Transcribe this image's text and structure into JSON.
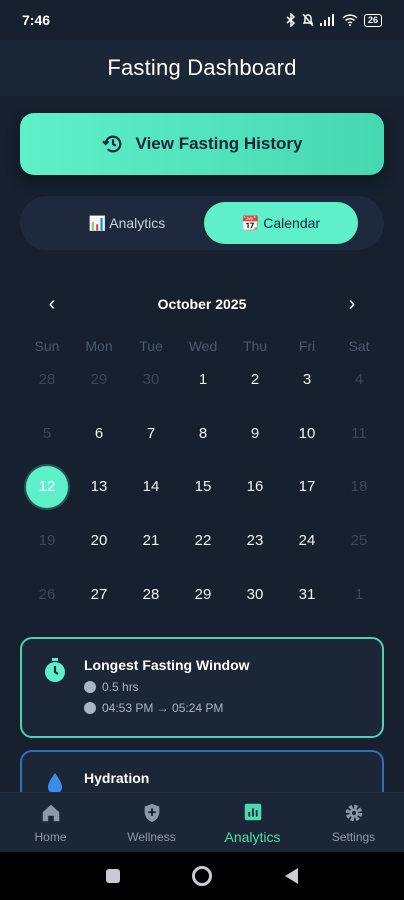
{
  "status_bar": {
    "time": "7:46",
    "battery": "26"
  },
  "header": {
    "title": "Fasting Dashboard"
  },
  "history_button": {
    "label": "View Fasting History",
    "icon": "history-icon"
  },
  "tabs": [
    {
      "label": "📊 Analytics",
      "active": false
    },
    {
      "label": "📆 Calendar",
      "active": true
    }
  ],
  "calendar": {
    "month": "October 2025",
    "prev": "‹",
    "next": "›",
    "weekdays": [
      "Sun",
      "Mon",
      "Tue",
      "Wed",
      "Thu",
      "Fri",
      "Sat"
    ],
    "days": [
      {
        "label": "28",
        "muted": true
      },
      {
        "label": "29",
        "muted": true
      },
      {
        "label": "30",
        "muted": true
      },
      {
        "label": "1"
      },
      {
        "label": "2"
      },
      {
        "label": "3"
      },
      {
        "label": "4",
        "muted": true
      },
      {
        "label": "5",
        "muted": true
      },
      {
        "label": "6"
      },
      {
        "label": "7"
      },
      {
        "label": "8"
      },
      {
        "label": "9"
      },
      {
        "label": "10"
      },
      {
        "label": "11",
        "muted": true
      },
      {
        "label": "12",
        "today": true
      },
      {
        "label": "13"
      },
      {
        "label": "14"
      },
      {
        "label": "15"
      },
      {
        "label": "16"
      },
      {
        "label": "17"
      },
      {
        "label": "18",
        "muted": true
      },
      {
        "label": "19",
        "muted": true
      },
      {
        "label": "20"
      },
      {
        "label": "21"
      },
      {
        "label": "22"
      },
      {
        "label": "23"
      },
      {
        "label": "24"
      },
      {
        "label": "25",
        "muted": true
      },
      {
        "label": "26",
        "muted": true
      },
      {
        "label": "27"
      },
      {
        "label": "28"
      },
      {
        "label": "29"
      },
      {
        "label": "30"
      },
      {
        "label": "31"
      },
      {
        "label": "1",
        "muted": true
      }
    ]
  },
  "fasting_card": {
    "title": "Longest Fasting Window",
    "duration": "0.5 hrs",
    "range": "04:53 PM → 05:24 PM",
    "accent": "#4ed1b0"
  },
  "hydration_card": {
    "title": "Hydration",
    "accent": "#2f6fb6"
  },
  "bottom_nav": [
    {
      "label": "Home",
      "icon": "home-icon",
      "active": false
    },
    {
      "label": "Wellness",
      "icon": "shield-icon",
      "active": false
    },
    {
      "label": "Analytics",
      "icon": "analytics-icon",
      "active": true
    },
    {
      "label": "Settings",
      "icon": "gear-icon",
      "active": false
    }
  ]
}
